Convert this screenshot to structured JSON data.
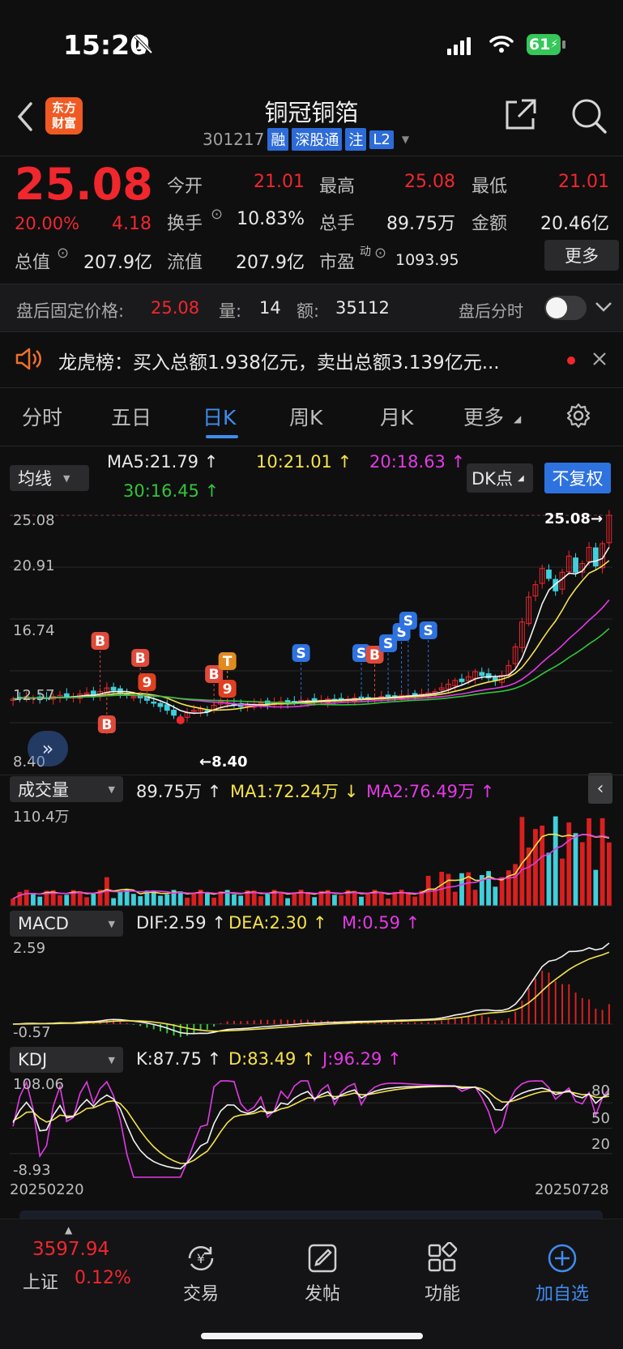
{
  "status_bar": {
    "time": "15:20",
    "battery": "61"
  },
  "header": {
    "title": "铜冠铜箔",
    "code": "301217",
    "tags": [
      "融",
      "深股通",
      "注",
      "L2"
    ]
  },
  "quote": {
    "price": "25.08",
    "change_pct": "20.00%",
    "change": "4.18",
    "fields": [
      {
        "label": "今开",
        "value": "21.01",
        "color": "red"
      },
      {
        "label": "最高",
        "value": "25.08",
        "color": "red"
      },
      {
        "label": "最低",
        "value": "21.01",
        "color": "red"
      },
      {
        "label": "换手",
        "value": "10.83%",
        "color": "white"
      },
      {
        "label": "总手",
        "value": "89.75万",
        "color": "white"
      },
      {
        "label": "金额",
        "value": "20.46亿",
        "color": "white"
      },
      {
        "label": "总值",
        "value": "207.9亿",
        "color": "white"
      },
      {
        "label": "流值",
        "value": "207.9亿",
        "color": "white"
      },
      {
        "label": "市盈",
        "value": "1093.95",
        "color": "white"
      }
    ],
    "pe_sup": "动",
    "more_label": "更多"
  },
  "after_hours": {
    "price_label": "盘后固定价格:",
    "price": "25.08",
    "vol_label": "量:",
    "vol": "14",
    "amt_label": "额:",
    "amt": "35112",
    "toggle_label": "盘后分时"
  },
  "news": {
    "text": "龙虎榜：买入总额1.938亿元，卖出总额3.139亿元..."
  },
  "tabs": [
    {
      "label": "分时"
    },
    {
      "label": "五日"
    },
    {
      "label": "日K"
    },
    {
      "label": "周K"
    },
    {
      "label": "月K"
    },
    {
      "label": "更多"
    }
  ],
  "kline": {
    "selector": "均线",
    "ma5": "MA5:21.79",
    "ma10": "10:21.01",
    "ma20": "20:18.63",
    "ma30": "30:16.45",
    "dk_label": "DK点",
    "fq_label": "不复权",
    "axis": [
      "25.08",
      "20.91",
      "16.74",
      "12.57",
      "8.40"
    ],
    "high_mark": "25.08",
    "low_mark": "8.40",
    "bs_marks": [
      "B",
      "B",
      "9",
      "B",
      "T",
      "9",
      "S",
      "S",
      "B",
      "S",
      "S",
      "S",
      "S",
      "B"
    ]
  },
  "volume": {
    "selector": "成交量",
    "value": "89.75万",
    "ma1": "MA1:72.24万",
    "ma2": "MA2:76.49万",
    "axis_top": "110.4万"
  },
  "macd": {
    "selector": "MACD",
    "dif": "DIF:2.59",
    "dea": "DEA:2.30",
    "m": "M:0.59",
    "axis_top": "2.59",
    "axis_bottom": "-0.57"
  },
  "kdj": {
    "selector": "KDJ",
    "k": "K:87.75",
    "d": "D:83.49",
    "j": "J:96.29",
    "axis_top": "108.06",
    "axis_bottom": "-8.93",
    "levels": [
      "80",
      "50",
      "20"
    ]
  },
  "dates": {
    "start": "20250220",
    "end": "20250728"
  },
  "bottom_nav": {
    "index_value": "3597.94",
    "index_name": "上证",
    "index_pct": "0.12%",
    "items": [
      "交易",
      "发帖",
      "功能",
      "加自选"
    ]
  },
  "chart_data": [
    {
      "type": "candlestick",
      "title": "",
      "ylim": [
        8.4,
        25.08
      ],
      "close_last": 25.08,
      "low_mark": 8.4,
      "closes": [
        10.3,
        10.4,
        10.5,
        10.4,
        10.3,
        10.4,
        10.5,
        10.6,
        10.4,
        10.5,
        10.7,
        10.8,
        10.6,
        10.9,
        11.2,
        11.0,
        10.8,
        10.6,
        10.5,
        10.4,
        10.2,
        10.0,
        9.7,
        9.4,
        9.0,
        8.8,
        9.2,
        9.4,
        9.5,
        9.3,
        9.8,
        10.1,
        10.0,
        9.8,
        9.7,
        9.8,
        9.9,
        10.0,
        9.9,
        10.0,
        10.1,
        10.0,
        10.1,
        10.2,
        10.2,
        10.1,
        10.2,
        10.3,
        10.2,
        10.3,
        10.3,
        10.4,
        10.3,
        10.4,
        10.4,
        10.5,
        10.5,
        10.5,
        10.6,
        10.6,
        10.7,
        10.7,
        10.8,
        10.9,
        11.2,
        11.5,
        11.8,
        11.7,
        12.1,
        12.5,
        12.2,
        12.0,
        11.8,
        12.2,
        13.0,
        14.5,
        16.5,
        18.5,
        19.5,
        20.8,
        20.0,
        19.0,
        20.5,
        21.8,
        20.5,
        21.2,
        22.5,
        21.0,
        22.8,
        25.08
      ]
    },
    {
      "type": "bar",
      "title": "",
      "ylim": [
        0,
        110.4
      ],
      "ymax_label": "110.4万"
    },
    {
      "type": "line",
      "title": "",
      "ylim": [
        -0.57,
        2.59
      ],
      "dif_last": 2.59,
      "dea_last": 2.3,
      "m_last": 0.59
    },
    {
      "type": "line",
      "title": "",
      "ylim": [
        -8.93,
        108.06
      ],
      "k_last": 87.75,
      "d_last": 83.49,
      "j_last": 96.29
    }
  ]
}
